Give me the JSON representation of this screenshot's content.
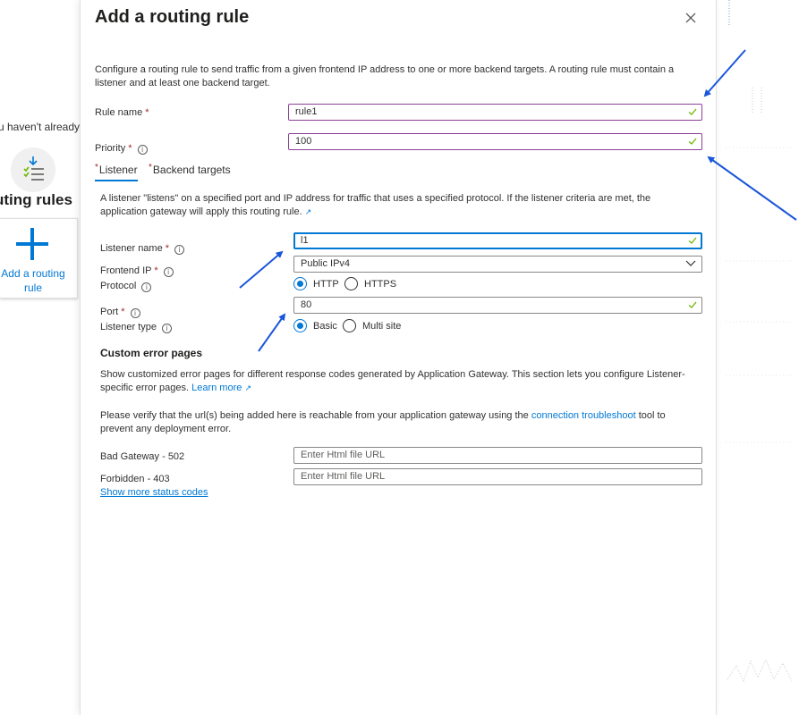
{
  "background": {
    "intro_fragment": "u haven't already, c",
    "routing_rules_heading": "uting rules",
    "add_card_label": "Add a routing rule"
  },
  "panel": {
    "title": "Add a routing rule",
    "description": "Configure a routing rule to send traffic from a given frontend IP address to one or more backend targets. A routing rule must contain a listener and at least one backend target.",
    "rule_name_label": "Rule name",
    "rule_name_value": "rule1",
    "priority_label": "Priority",
    "priority_value": "100",
    "tabs": [
      {
        "label": "Listener"
      },
      {
        "label": "Backend targets"
      }
    ],
    "listener": {
      "description": "A listener \"listens\" on a specified port and IP address for traffic that uses a specified protocol. If the listener criteria are met, the application gateway will apply this routing rule.",
      "listener_name_label": "Listener name",
      "listener_name_value": "l1",
      "frontend_ip_label": "Frontend IP",
      "frontend_ip_value": "Public IPv4",
      "protocol_label": "Protocol",
      "protocol_options": [
        "HTTP",
        "HTTPS"
      ],
      "protocol_selected": "HTTP",
      "port_label": "Port",
      "port_value": "80",
      "listener_type_label": "Listener type",
      "listener_type_options": [
        "Basic",
        "Multi site"
      ],
      "listener_type_selected": "Basic"
    },
    "custom_error_pages": {
      "title": "Custom error pages",
      "description": "Show customized error pages for different response codes generated by Application Gateway. This section lets you configure Listener-specific error pages.",
      "learn_more": "Learn more",
      "verify_text_before": "Please verify that the url(s) being added here is reachable from your application gateway using the ",
      "verify_link": "connection troubleshoot",
      "verify_text_after": " tool to prevent any deployment error.",
      "bad_gateway_label": "Bad Gateway - 502",
      "bad_gateway_placeholder": "Enter Html file URL",
      "forbidden_label": "Forbidden - 403",
      "forbidden_placeholder": "Enter Html file URL",
      "show_more": "Show more status codes"
    }
  },
  "colors": {
    "accent": "#0078d4",
    "required": "#a4262c",
    "valid_check": "#6bb700",
    "annotation_arrow": "#1a56db"
  }
}
